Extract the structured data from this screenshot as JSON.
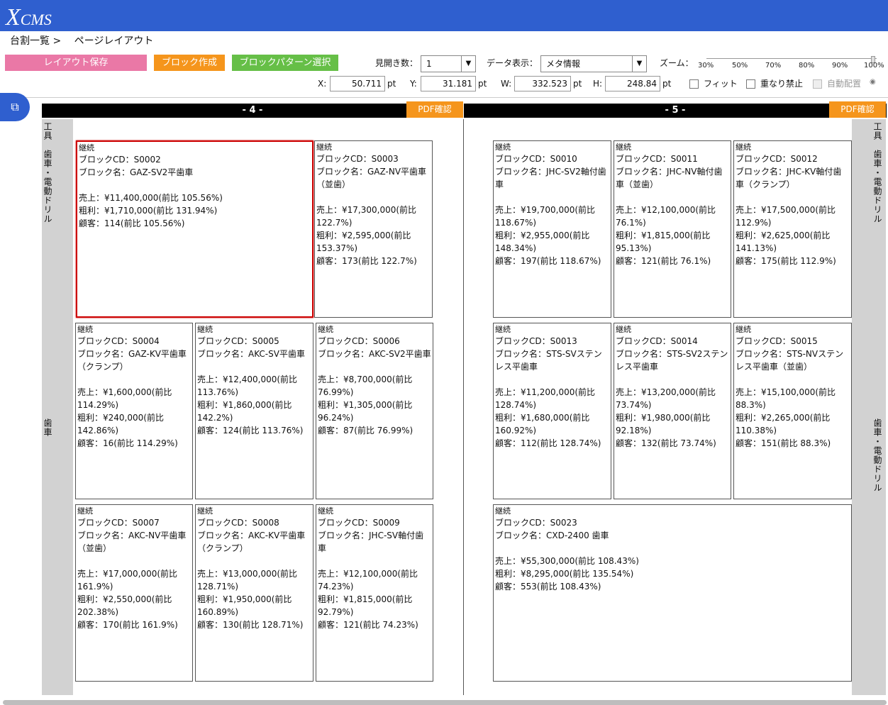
{
  "header": {
    "logo": "XCMS",
    "logo_big": "X",
    "logo_small": "CMS"
  },
  "breadcrumb": {
    "parent": "台割一覧 >",
    "current": "ページレイアウト"
  },
  "toolbar": {
    "save_label": "レイアウト保存",
    "block_label": "ブロック作成",
    "pattern_label": "ブロックパターン選択",
    "spread_label": "見開き数：",
    "spread_value": "1",
    "data_display_label": "データ表示：",
    "data_display_value": "メタ情報",
    "zoom_label": "ズーム：",
    "zoom_ticks": [
      "30%",
      "50%",
      "70%",
      "80%",
      "90%",
      "100%"
    ],
    "zoom_value": 100,
    "x_label": "X:",
    "x_value": "50.711",
    "y_label": "Y:",
    "y_value": "31.181",
    "w_label": "W:",
    "w_value": "332.523",
    "h_label": "H:",
    "h_value": "248.84",
    "unit": "pt",
    "fit_label": "フィット",
    "overlap_label": "重なり禁止",
    "auto_label": "自動配置"
  },
  "pages": [
    {
      "number": "- 4 -",
      "pdf_label": "PDF確認",
      "side_label_top": "工具　歯車・電動ドリル",
      "side_label_mid": "歯車"
    },
    {
      "number": "- 5 -",
      "pdf_label": "PDF確認",
      "side_label_top": "工具　歯車・電動ドリル",
      "side_label_mid": "歯車・電動ドリル"
    }
  ],
  "blocks": [
    {
      "status": "継続",
      "lines": [
        "ブロックCD：S0002",
        "ブロック名：GAZ-SV2平歯車"
      ],
      "stats": [
        "売上：¥11,400,000(前比 105.56%)",
        "粗利：¥1,710,000(前比 131.94%)",
        "顧客：114(前比 105.56%)"
      ]
    },
    {
      "status": "継続",
      "lines": [
        "ブロックCD：S0003",
        "ブロック名：GAZ-NV平歯車",
        "（並歯）"
      ],
      "stats": [
        "売上：¥17,300,000(前比",
        "122.7%)",
        "粗利：¥2,595,000(前比",
        "153.37%)",
        "顧客：173(前比 122.7%)"
      ]
    },
    {
      "status": "継続",
      "lines": [
        "ブロックCD：S0004",
        "ブロック名：GAZ-KV平歯車",
        "（クランプ）"
      ],
      "stats": [
        "売上：¥1,600,000(前比",
        "114.29%)",
        "粗利：¥240,000(前比",
        "142.86%)",
        "顧客：16(前比 114.29%)"
      ]
    },
    {
      "status": "継続",
      "lines": [
        "ブロックCD：S0005",
        "ブロック名：AKC-SV平歯車"
      ],
      "stats": [
        "売上：¥12,400,000(前比",
        "113.76%)",
        "粗利：¥1,860,000(前比",
        "142.2%)",
        "顧客：124(前比 113.76%)"
      ]
    },
    {
      "status": "継続",
      "lines": [
        "ブロックCD：S0006",
        "ブロック名：AKC-SV2平歯車"
      ],
      "stats": [
        "売上：¥8,700,000(前比",
        "76.99%)",
        "粗利：¥1,305,000(前比",
        "96.24%)",
        "顧客：87(前比 76.99%)"
      ]
    },
    {
      "status": "継続",
      "lines": [
        "ブロックCD：S0007",
        "ブロック名：AKC-NV平歯車",
        "（並歯）"
      ],
      "stats": [
        "売上：¥17,000,000(前比",
        "161.9%)",
        "粗利：¥2,550,000(前比",
        "202.38%)",
        "顧客：170(前比 161.9%)"
      ]
    },
    {
      "status": "継続",
      "lines": [
        "ブロックCD：S0008",
        "ブロック名：AKC-KV平歯車",
        "（クランプ）"
      ],
      "stats": [
        "売上：¥13,000,000(前比",
        "128.71%)",
        "粗利：¥1,950,000(前比",
        "160.89%)",
        "顧客：130(前比 128.71%)"
      ]
    },
    {
      "status": "継続",
      "lines": [
        "ブロックCD：S0009",
        "ブロック名：JHC-SV軸付歯",
        "車"
      ],
      "stats": [
        "売上：¥12,100,000(前比",
        "74.23%)",
        "粗利：¥1,815,000(前比",
        "92.79%)",
        "顧客：121(前比 74.23%)"
      ]
    },
    {
      "status": "継続",
      "lines": [
        "ブロックCD：S0010",
        "ブロック名：JHC-SV2軸付歯",
        "車"
      ],
      "stats": [
        "売上：¥19,700,000(前比",
        "118.67%)",
        "粗利：¥2,955,000(前比",
        "148.34%)",
        "顧客：197(前比 118.67%)"
      ]
    },
    {
      "status": "継続",
      "lines": [
        "ブロックCD：S0011",
        "ブロック名：JHC-NV軸付歯",
        "車（並歯）"
      ],
      "stats": [
        "売上：¥12,100,000(前比",
        "76.1%)",
        "粗利：¥1,815,000(前比",
        "95.13%)",
        "顧客：121(前比 76.1%)"
      ]
    },
    {
      "status": "継続",
      "lines": [
        "ブロックCD：S0012",
        "ブロック名：JHC-KV軸付歯",
        "車（クランプ）"
      ],
      "stats": [
        "売上：¥17,500,000(前比",
        "112.9%)",
        "粗利：¥2,625,000(前比",
        "141.13%)",
        "顧客：175(前比 112.9%)"
      ]
    },
    {
      "status": "継続",
      "lines": [
        "ブロックCD：S0013",
        "ブロック名：STS-SVステン",
        "レス平歯車"
      ],
      "stats": [
        "売上：¥11,200,000(前比",
        "128.74%)",
        "粗利：¥1,680,000(前比",
        "160.92%)",
        "顧客：112(前比 128.74%)"
      ]
    },
    {
      "status": "継続",
      "lines": [
        "ブロックCD：S0014",
        "ブロック名：STS-SV2ステン",
        "レス平歯車"
      ],
      "stats": [
        "売上：¥13,200,000(前比",
        "73.74%)",
        "粗利：¥1,980,000(前比",
        "92.18%)",
        "顧客：132(前比 73.74%)"
      ]
    },
    {
      "status": "継続",
      "lines": [
        "ブロックCD：S0015",
        "ブロック名：STS-NVステン",
        "レス平歯車（並歯）"
      ],
      "stats": [
        "売上：¥15,100,000(前比",
        "88.3%)",
        "粗利：¥2,265,000(前比",
        "110.38%)",
        "顧客：151(前比 88.3%)"
      ]
    },
    {
      "status": "継続",
      "lines": [
        "ブロックCD：S0023",
        "ブロック名：CXD-2400 歯車"
      ],
      "stats": [
        "売上：¥55,300,000(前比 108.43%)",
        "粗利：¥8,295,000(前比 135.54%)",
        "顧客：553(前比 108.43%)"
      ]
    }
  ]
}
